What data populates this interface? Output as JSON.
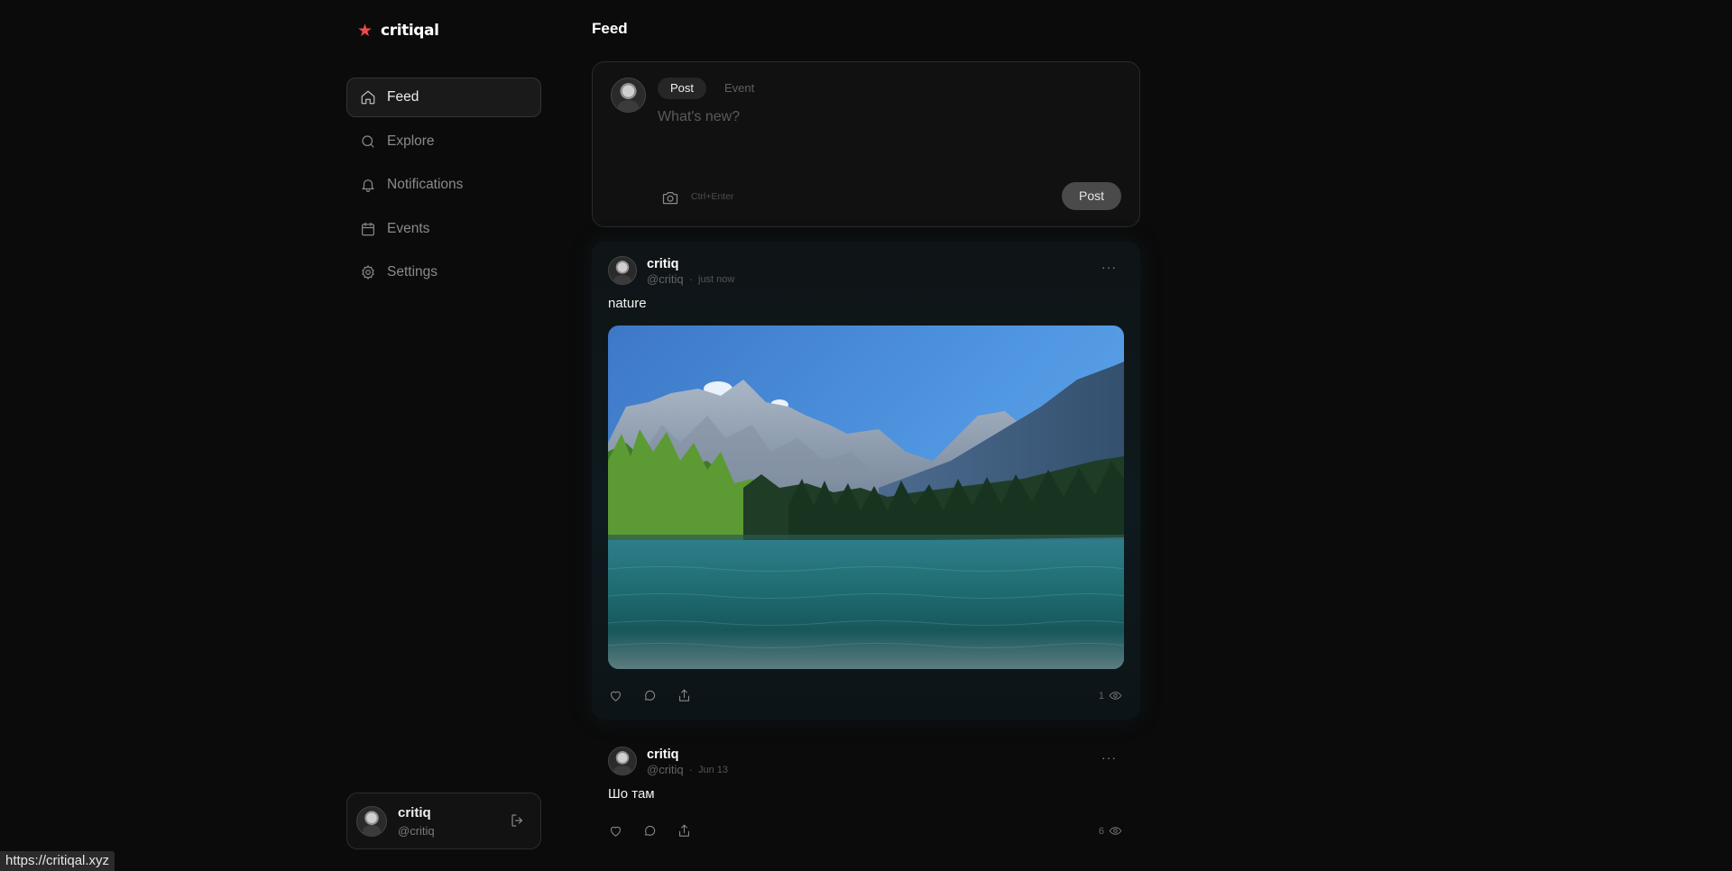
{
  "brand": {
    "name": "critiqal",
    "accent_color": "#ef4b4b"
  },
  "nav": {
    "items": [
      {
        "label": "Feed",
        "icon": "home-icon",
        "active": true
      },
      {
        "label": "Explore",
        "icon": "search-icon",
        "active": false
      },
      {
        "label": "Notifications",
        "icon": "bell-icon",
        "active": false
      },
      {
        "label": "Events",
        "icon": "calendar-icon",
        "active": false
      },
      {
        "label": "Settings",
        "icon": "gear-icon",
        "active": false
      }
    ]
  },
  "current_user": {
    "name": "critiq",
    "handle": "@critiq"
  },
  "page": {
    "title": "Feed"
  },
  "composer": {
    "tabs": [
      {
        "label": "Post",
        "active": true
      },
      {
        "label": "Event",
        "active": false
      }
    ],
    "placeholder": "What's new?",
    "shortcut_hint": "Ctrl+Enter",
    "submit_label": "Post"
  },
  "posts": [
    {
      "author": "critiq",
      "handle": "@critiq",
      "separator": "·",
      "time": "just now",
      "text": "nature",
      "views": "1"
    },
    {
      "author": "critiq",
      "handle": "@critiq",
      "separator": "·",
      "time": "Jun 13",
      "text": "Шо там",
      "views": "6"
    }
  ],
  "status_bar": {
    "url": "https://critiqal.xyz"
  }
}
